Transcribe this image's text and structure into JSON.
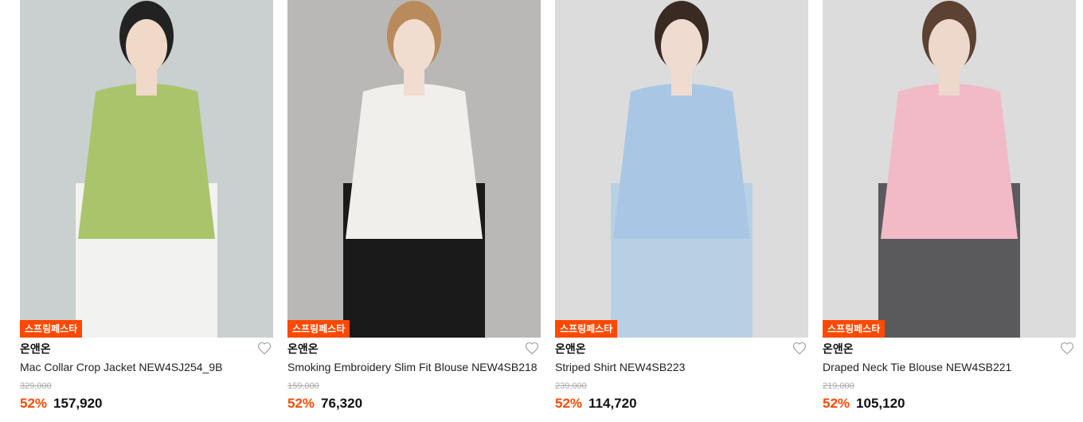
{
  "products": [
    {
      "badge": "스프링페스타",
      "brand": "온앤온",
      "name": "Mac Collar Crop Jacket NEW4SJ254_9B",
      "original_price": "329,000",
      "discount_rate": "52%",
      "sale_price": "157,920",
      "colors": {
        "bg": "#c9d0cf",
        "top": "#a9c46a",
        "bottom": "#f2f2f0",
        "skin": "#f0d9c8",
        "hair": "#222222"
      }
    },
    {
      "badge": "스프링페스타",
      "brand": "온앤온",
      "name": "Smoking Embroidery Slim Fit Blouse NEW4SB218",
      "original_price": "159,000",
      "discount_rate": "52%",
      "sale_price": "76,320",
      "colors": {
        "bg": "#b9b8b6",
        "top": "#f0efec",
        "bottom": "#1a1a1a",
        "skin": "#f1dcd0",
        "hair": "#b98a5c"
      }
    },
    {
      "badge": "스프링페스타",
      "brand": "온앤온",
      "name": "Striped Shirt NEW4SB223",
      "original_price": "239,000",
      "discount_rate": "52%",
      "sale_price": "114,720",
      "colors": {
        "bg": "#dcdcdc",
        "top": "#a9c7e4",
        "bottom": "#b8d0e3",
        "skin": "#f0dbd0",
        "hair": "#3a2b22"
      }
    },
    {
      "badge": "스프링페스타",
      "brand": "온앤온",
      "name": "Draped Neck Tie Blouse NEW4SB221",
      "original_price": "219,000",
      "discount_rate": "52%",
      "sale_price": "105,120",
      "colors": {
        "bg": "#dcdcdc",
        "top": "#f2b9c7",
        "bottom": "#5a5a5c",
        "skin": "#eed8cc",
        "hair": "#5b4233"
      }
    }
  ]
}
